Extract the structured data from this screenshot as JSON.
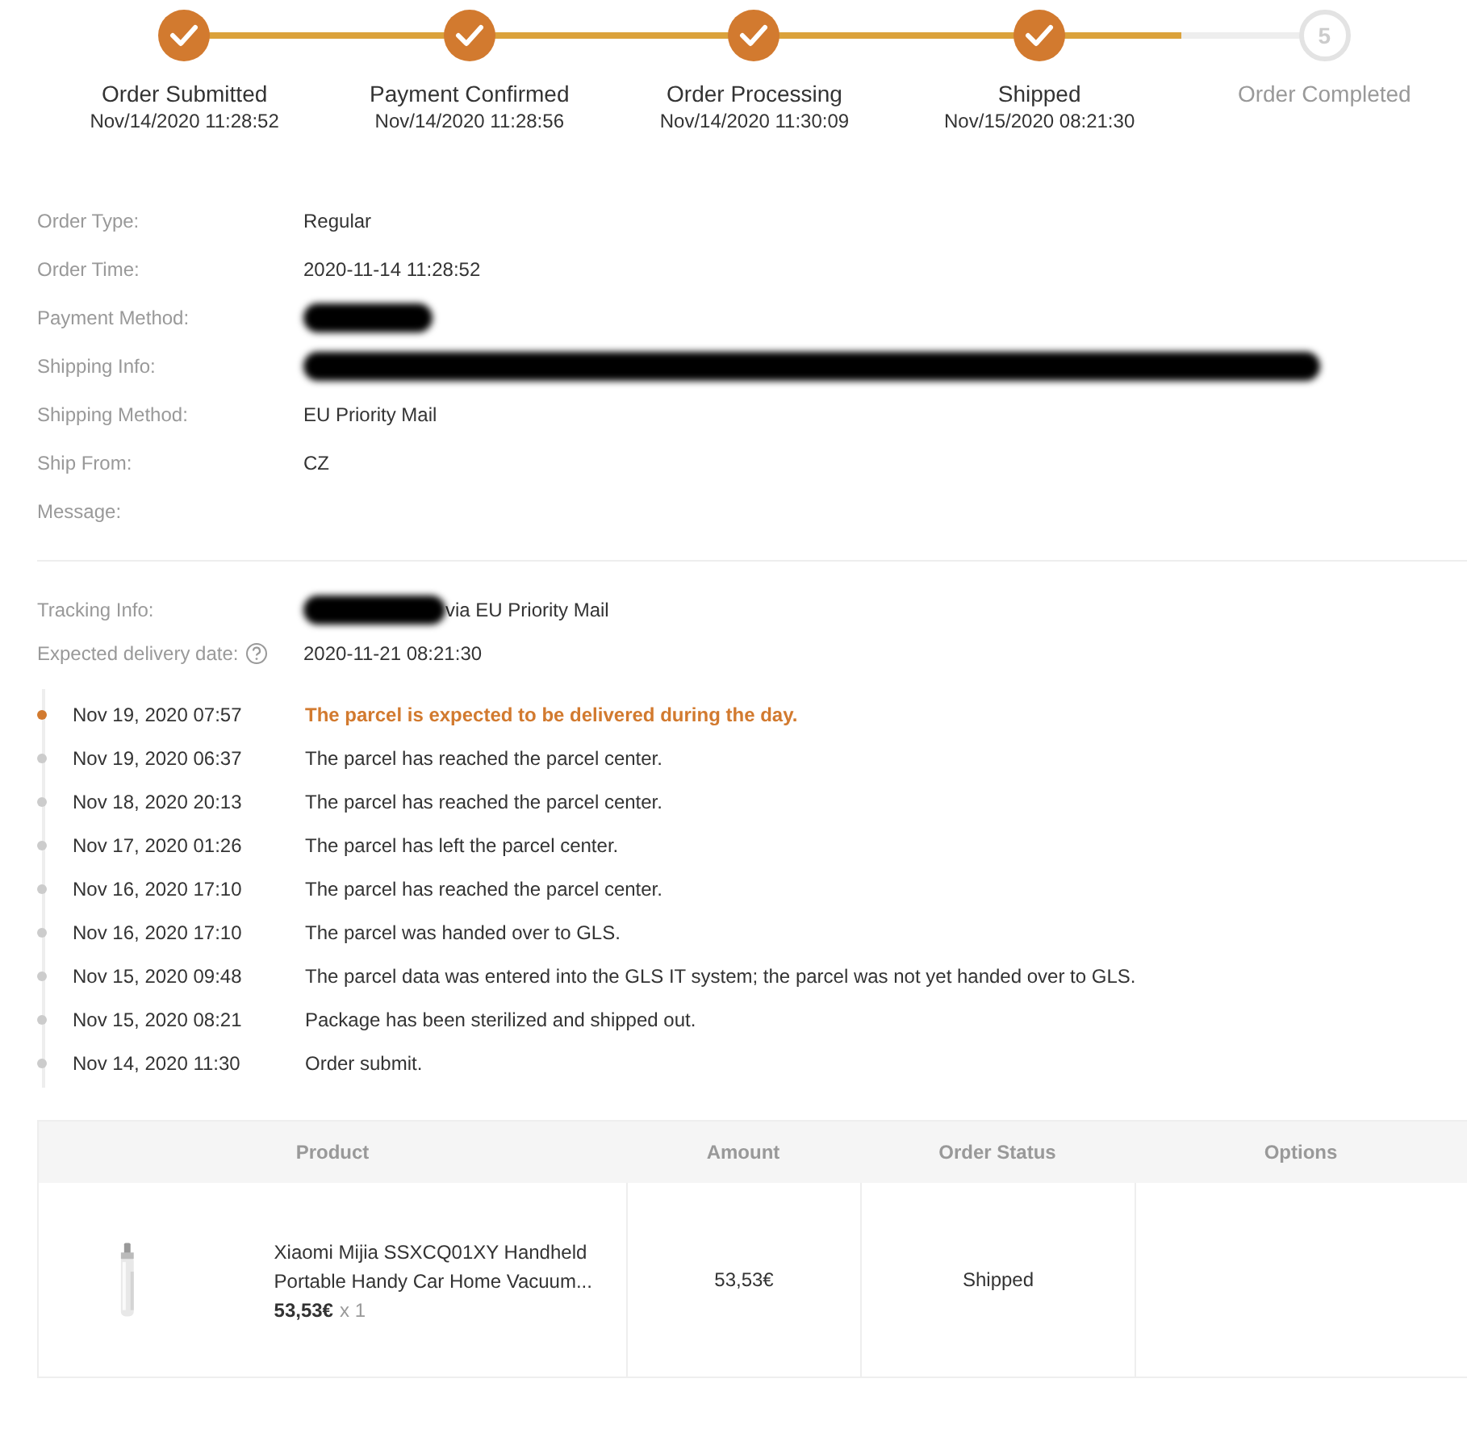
{
  "steps": [
    {
      "label": "Order Submitted",
      "time": "Nov/14/2020 11:28:52",
      "done": true
    },
    {
      "label": "Payment Confirmed",
      "time": "Nov/14/2020 11:28:56",
      "done": true
    },
    {
      "label": "Order Processing",
      "time": "Nov/14/2020 11:30:09",
      "done": true
    },
    {
      "label": "Shipped",
      "time": "Nov/15/2020 08:21:30",
      "done": true
    },
    {
      "label": "Order Completed",
      "done": false,
      "number": "5"
    }
  ],
  "details": [
    {
      "label": "Order Type:",
      "value": "Regular"
    },
    {
      "label": "Order Time:",
      "value": "2020-11-14 11:28:52"
    },
    {
      "label": "Payment Method:",
      "kind": "mask"
    },
    {
      "label": "Shipping Info:",
      "kind": "bar"
    },
    {
      "label": "Shipping Method:",
      "value": "EU Priority Mail"
    },
    {
      "label": "Ship From:",
      "value": "CZ"
    },
    {
      "label": "Message:"
    }
  ],
  "tracking": {
    "label": "Tracking Info:",
    "kind": "mask",
    "value": "via EU Priority Mail"
  },
  "expected": {
    "label": "Expected delivery date:",
    "value": "2020-11-21 08:21:30"
  },
  "events": [
    {
      "time": "Nov 19, 2020 07:57",
      "text": "The parcel is expected to be delivered during the day.",
      "latest": true
    },
    {
      "time": "Nov 19, 2020 06:37",
      "text": "The parcel has reached the parcel center.",
      "latest": false
    },
    {
      "time": "Nov 18, 2020 20:13",
      "text": "The parcel has reached the parcel center.",
      "latest": false
    },
    {
      "time": "Nov 17, 2020 01:26",
      "text": "The parcel has left the parcel center.",
      "latest": false
    },
    {
      "time": "Nov 16, 2020 17:10",
      "text": "The parcel has reached the parcel center.",
      "latest": false
    },
    {
      "time": "Nov 16, 2020 17:10",
      "text": "The parcel was handed over to GLS.",
      "latest": false
    },
    {
      "time": "Nov 15, 2020 09:48",
      "text": "The parcel data was entered into the GLS IT system; the parcel was not yet handed over to GLS.",
      "latest": false
    },
    {
      "time": "Nov 15, 2020 08:21",
      "text": "Package has been sterilized and shipped out.",
      "latest": false
    },
    {
      "time": "Nov 14, 2020 11:30",
      "text": "Order submit.",
      "latest": false
    }
  ],
  "table": {
    "columns": [
      "Product",
      "Amount",
      "Order Status",
      "Options"
    ],
    "rows": [
      {
        "title": "Xiaomi Mijia SSXCQ01XY Handheld Portable Handy Car Home Vacuum...",
        "price": "53,53€",
        "quantity": "x 1",
        "amount": "53,53€",
        "status": "Shipped"
      }
    ]
  }
}
